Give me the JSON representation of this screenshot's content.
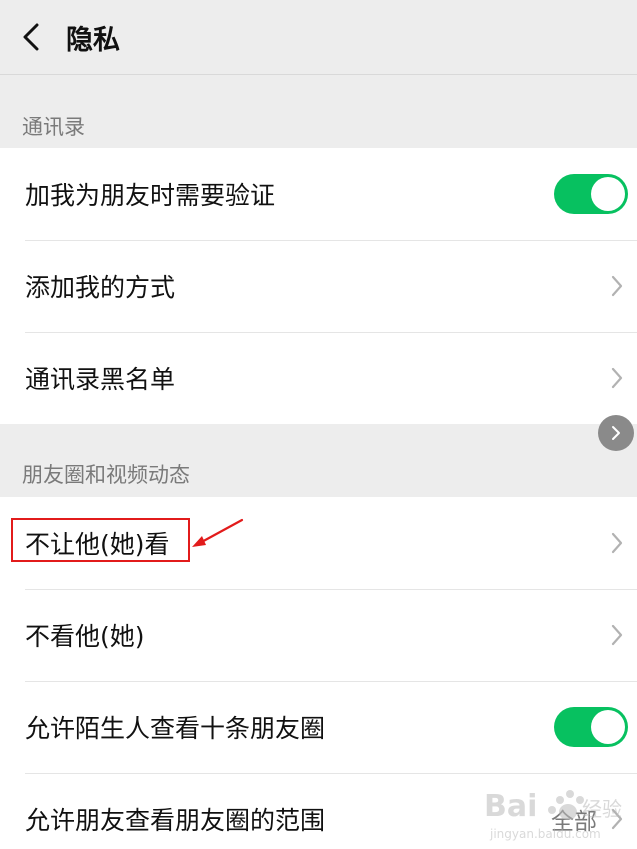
{
  "header": {
    "title": "隐私",
    "back_icon": "chevron-left-icon"
  },
  "sections": [
    {
      "label": "通讯录",
      "rows": [
        {
          "label": "加我为朋友时需要验证",
          "control": "toggle",
          "on": true
        },
        {
          "label": "添加我的方式",
          "control": "chevron"
        },
        {
          "label": "通讯录黑名单",
          "control": "chevron"
        }
      ]
    },
    {
      "label": "朋友圈和视频动态",
      "rows": [
        {
          "label": "不让他(她)看",
          "control": "chevron",
          "highlighted": true
        },
        {
          "label": "不看他(她)",
          "control": "chevron"
        },
        {
          "label": "允许陌生人查看十条朋友圈",
          "control": "toggle",
          "on": true
        },
        {
          "label": "允许朋友查看朋友圈的范围",
          "control": "chevron",
          "value": "全部"
        }
      ]
    }
  ],
  "colors": {
    "accent": "#07c160",
    "annotation": "#e21b1b",
    "background": "#ededed"
  },
  "floating_button_icon": "chevron-right-icon"
}
